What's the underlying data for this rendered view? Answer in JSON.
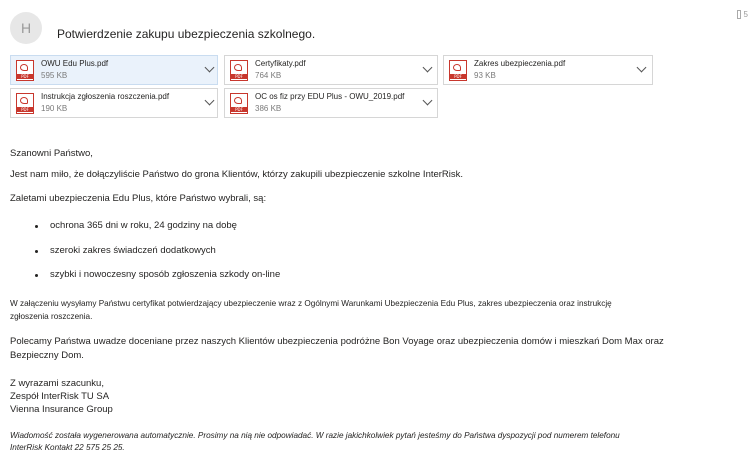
{
  "header": {
    "avatar_initial": "H",
    "subject": "Potwierdzenie zakupu ubezpieczenia szkolnego.",
    "corner_count": "5"
  },
  "attachments": [
    {
      "name": "OWU Edu Plus.pdf",
      "size": "595 KB",
      "icon": "pdf-icon",
      "selected": true
    },
    {
      "name": "Certyfikaty.pdf",
      "size": "764 KB",
      "icon": "pdf-icon",
      "selected": false
    },
    {
      "name": "Zakres ubezpieczenia.pdf",
      "size": "93 KB",
      "icon": "pdf-icon",
      "selected": false
    },
    {
      "name": "Instrukcja zgłoszenia roszczenia.pdf",
      "size": "190 KB",
      "icon": "pdf-icon",
      "selected": false
    },
    {
      "name": "OC os fiz przy EDU Plus - OWU_2019.pdf",
      "size": "386 KB",
      "icon": "pdf-icon",
      "selected": false
    }
  ],
  "pdf_badge": "PDF",
  "body": {
    "greeting": "Szanowni Państwo,",
    "intro": "Jest nam miło, że dołączyliście Państwo do grona Klientów, którzy zakupili ubezpieczenie szkolne InterRisk.",
    "benefits_intro": "Zaletami ubezpieczenia Edu Plus, które Państwo wybrali, są:",
    "bullets": [
      "ochrona 365 dni w roku, 24 godziny na dobę",
      "szeroki zakres świadczeń dodatkowych",
      "szybki i nowoczesny sposób zgłoszenia szkody on-line"
    ],
    "attachment_note_line1": "W załączeniu wysyłamy Państwu certyfikat potwierdzający ubezpieczenie wraz z Ogólnymi Warunkami Ubezpieczenia Edu Plus, zakres ubezpieczenia oraz instrukcję",
    "attachment_note_line2": "zgłoszenia roszczenia.",
    "recommend_line1": "Polecamy Państwa uwadze doceniane przez naszych Klientów ubezpieczenia podróżne Bon Voyage oraz ubezpieczenia domów i mieszkań Dom Max oraz",
    "recommend_line2": "Bezpieczny Dom.",
    "closing": "Z wyrazami szacunku,",
    "signature_company": "Zespół InterRisk TU SA",
    "signature_group": "Vienna Insurance Group",
    "footer_line1": "Wiadomość została wygenerowana automatycznie. Prosimy na nią nie odpowiadać. W razie jakichkolwiek pytań jesteśmy do Państwa dyspozycji pod numerem telefonu",
    "footer_line2": "InterRisk Kontakt 22 575 25 25."
  }
}
